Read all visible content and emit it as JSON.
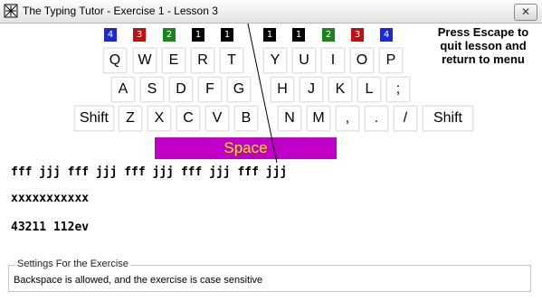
{
  "window": {
    "title": "The Typing Tutor - Exercise 1 - Lesson 3",
    "close_glyph": "✕"
  },
  "finger_indicators": [
    "4",
    "3",
    "2",
    "1",
    "1",
    "1",
    "1",
    "2",
    "3",
    "4"
  ],
  "keyboard": {
    "row1": [
      "Q",
      "W",
      "E",
      "R",
      "T",
      "Y",
      "U",
      "I",
      "O",
      "P"
    ],
    "row2": [
      "A",
      "S",
      "D",
      "F",
      "G",
      "H",
      "J",
      "K",
      "L",
      ";"
    ],
    "row3": [
      "Shift",
      "Z",
      "X",
      "C",
      "V",
      "B",
      "N",
      "M",
      ",",
      ".",
      "/",
      "Shift"
    ],
    "space": "Space"
  },
  "escape_message": "Press Escape to quit lesson and return to menu",
  "drill": {
    "line1": "fff jjj fff jjj fff jjj fff jjj fff jjj",
    "line2": "xxxxxxxxxxx",
    "line3": "43211 112ev"
  },
  "settings": {
    "legend": "Settings For the Exercise",
    "text": "Backspace is allowed, and the exercise is case sensitive"
  },
  "colors": {
    "blue": "#1c29d8",
    "red": "#c40e0e",
    "green": "#16881a",
    "space_bg": "#c000c8",
    "space_text": "#ffee00"
  }
}
